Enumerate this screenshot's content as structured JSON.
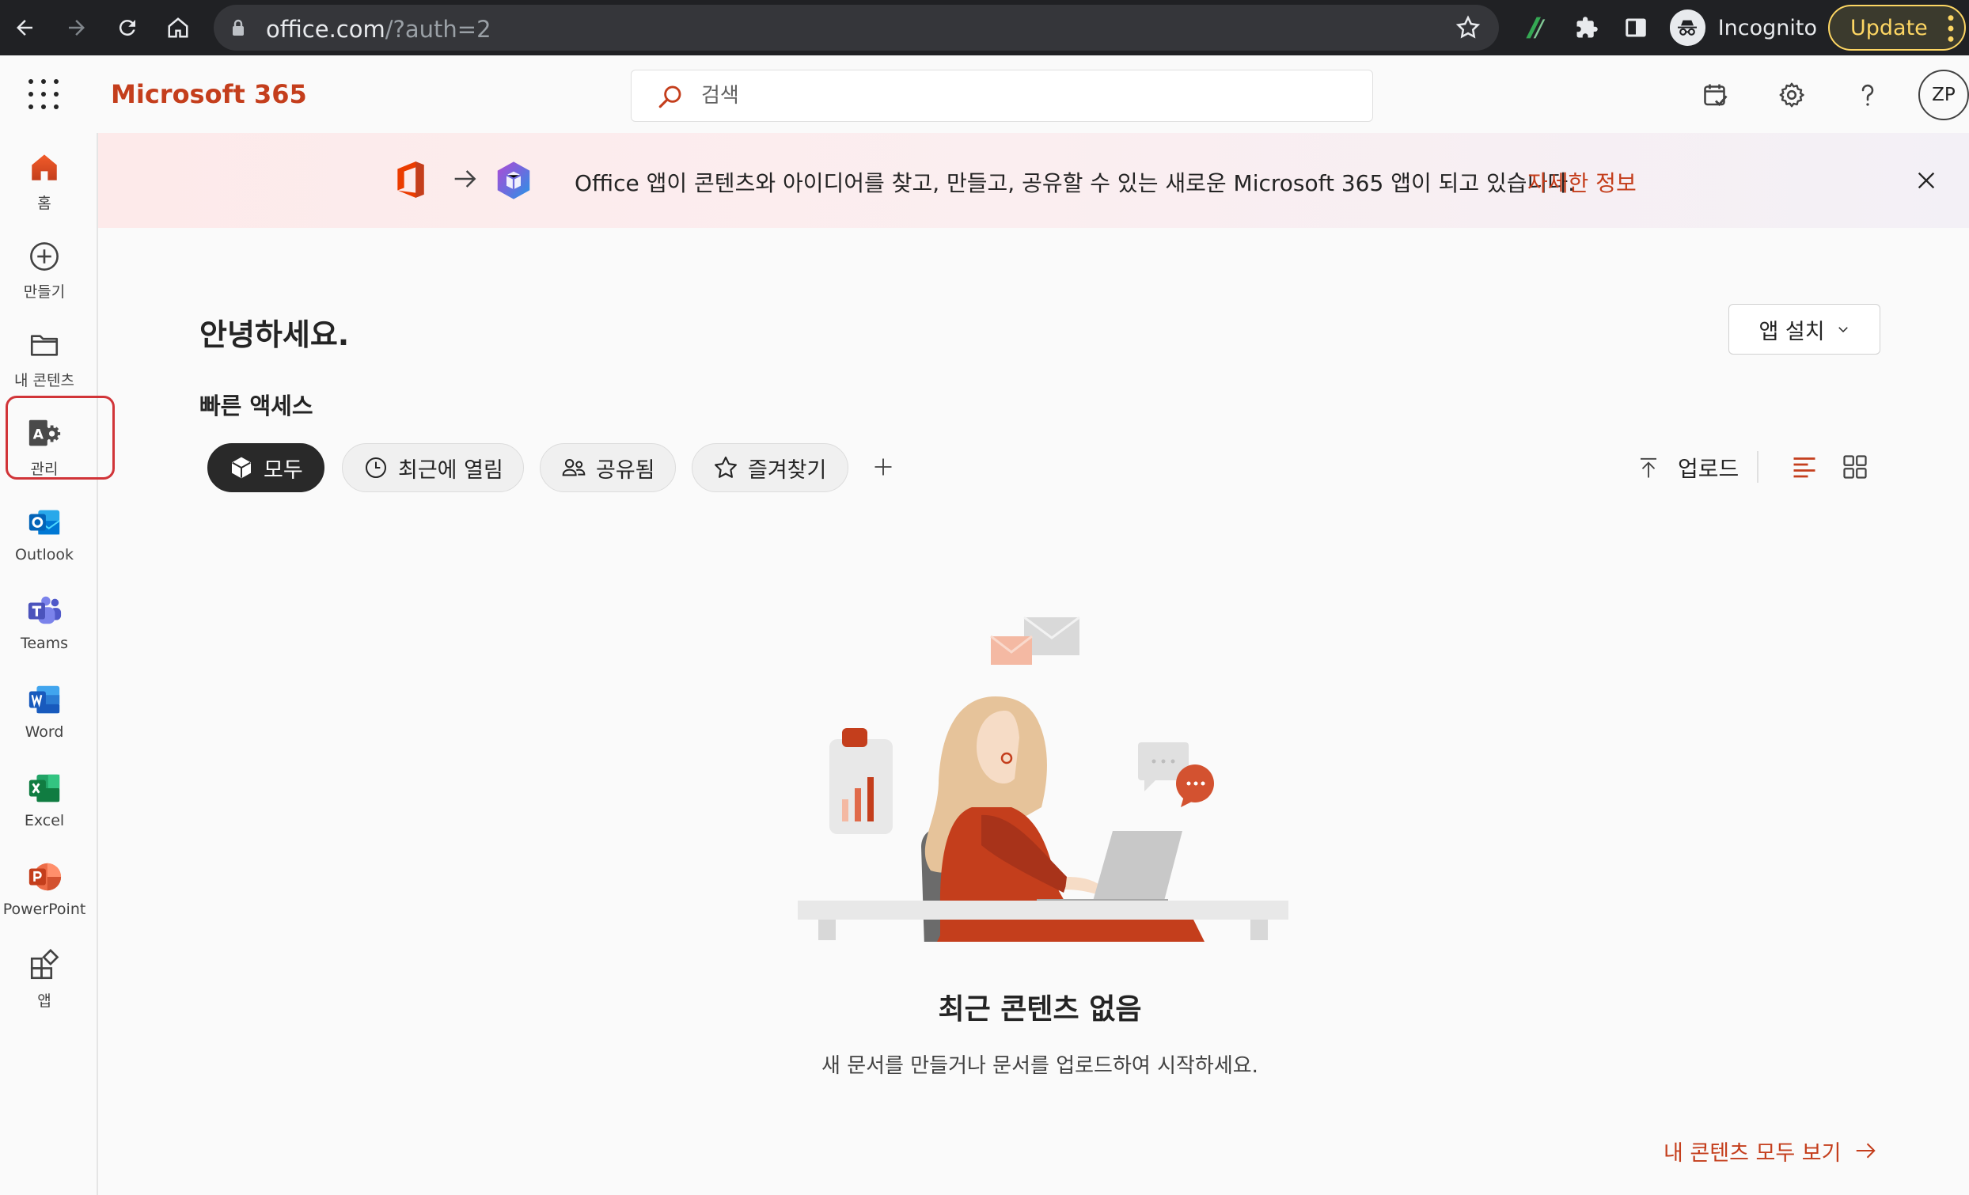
{
  "browser": {
    "url_host": "office.com",
    "url_path": "/?auth=2",
    "incognito_label": "Incognito",
    "update_label": "Update"
  },
  "header": {
    "brand": "Microsoft 365",
    "search_placeholder": "검색",
    "avatar_initials": "ZP"
  },
  "rail": {
    "items": [
      {
        "label": "홈",
        "icon": "home-icon"
      },
      {
        "label": "만들기",
        "icon": "create-plus-icon"
      },
      {
        "label": "내 콘텐츠",
        "icon": "folder-icon"
      },
      {
        "label": "관리",
        "icon": "admin-icon"
      },
      {
        "label": "Outlook",
        "icon": "outlook-icon"
      },
      {
        "label": "Teams",
        "icon": "teams-icon"
      },
      {
        "label": "Word",
        "icon": "word-icon"
      },
      {
        "label": "Excel",
        "icon": "excel-icon"
      },
      {
        "label": "PowerPoint",
        "icon": "powerpoint-icon"
      },
      {
        "label": "앱",
        "icon": "apps-icon"
      }
    ]
  },
  "banner": {
    "message": "Office 앱이 콘텐츠와 아이디어를 찾고, 만들고, 공유할 수 있는 새로운 Microsoft 365 앱이 되고 있습니다.",
    "link": "자세한 정보"
  },
  "main": {
    "greeting": "안녕하세요.",
    "install_label": "앱 설치",
    "quick_access": "빠른 액세스",
    "filters": [
      {
        "label": "모두",
        "active": true
      },
      {
        "label": "최근에 열림",
        "active": false
      },
      {
        "label": "공유됨",
        "active": false
      },
      {
        "label": "즐겨찾기",
        "active": false
      }
    ],
    "upload_label": "업로드",
    "empty_title": "최근 콘텐츠 없음",
    "empty_subtitle": "새 문서를 만들거나 문서를 업로드하여 시작하세요.",
    "view_all": "내 콘텐츠 모두 보기"
  },
  "colors": {
    "accent": "#c43e1c",
    "highlight": "#d13438",
    "chrome": "#202124"
  }
}
